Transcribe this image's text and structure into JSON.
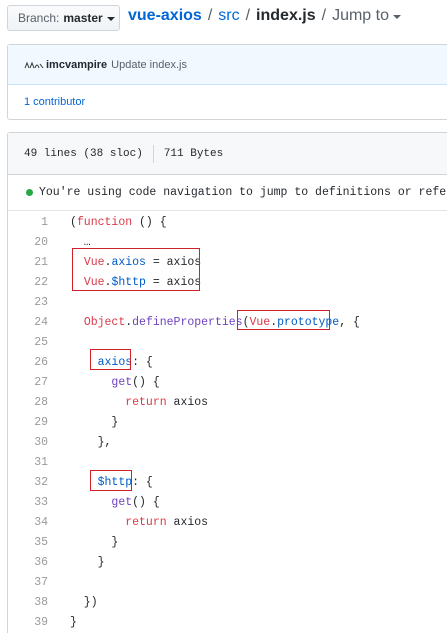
{
  "header": {
    "branch_label": "Branch:",
    "branch_value": "master",
    "repo": "vue-axios",
    "sep1": "/",
    "dir": "src",
    "sep2": "/",
    "file": "index.js",
    "sep3": "/",
    "jump_to": "Jump to"
  },
  "commit": {
    "author": "imcvampire",
    "message": "Update index.js",
    "contributors": "1 contributor"
  },
  "file_info": {
    "lines": "49 lines (38 sloc)",
    "size": "711 Bytes"
  },
  "code_nav": {
    "message": "You're using code navigation to jump to definitions or references."
  },
  "code_lines": [
    {
      "n": "1",
      "t": "(function () {"
    },
    {
      "n": "20",
      "t": "  …"
    },
    {
      "n": "21",
      "t": "  Vue.axios = axios"
    },
    {
      "n": "22",
      "t": "  Vue.$http = axios"
    },
    {
      "n": "23",
      "t": ""
    },
    {
      "n": "24",
      "t": "  Object.defineProperties(Vue.prototype, {"
    },
    {
      "n": "25",
      "t": ""
    },
    {
      "n": "26",
      "t": "    axios: {"
    },
    {
      "n": "27",
      "t": "      get() {"
    },
    {
      "n": "28",
      "t": "        return axios"
    },
    {
      "n": "29",
      "t": "      }"
    },
    {
      "n": "30",
      "t": "    },"
    },
    {
      "n": "31",
      "t": ""
    },
    {
      "n": "32",
      "t": "    $http: {"
    },
    {
      "n": "33",
      "t": "      get() {"
    },
    {
      "n": "34",
      "t": "        return axios"
    },
    {
      "n": "35",
      "t": "      }"
    },
    {
      "n": "36",
      "t": "    }"
    },
    {
      "n": "37",
      "t": ""
    },
    {
      "n": "38",
      "t": "  })"
    },
    {
      "n": "39",
      "t": "}"
    }
  ],
  "colors": {
    "link": "#0366d6",
    "keyword": "#d73a49",
    "function": "#6f42c1",
    "constant": "#005cc5",
    "highlight_box": "#d0202a"
  }
}
